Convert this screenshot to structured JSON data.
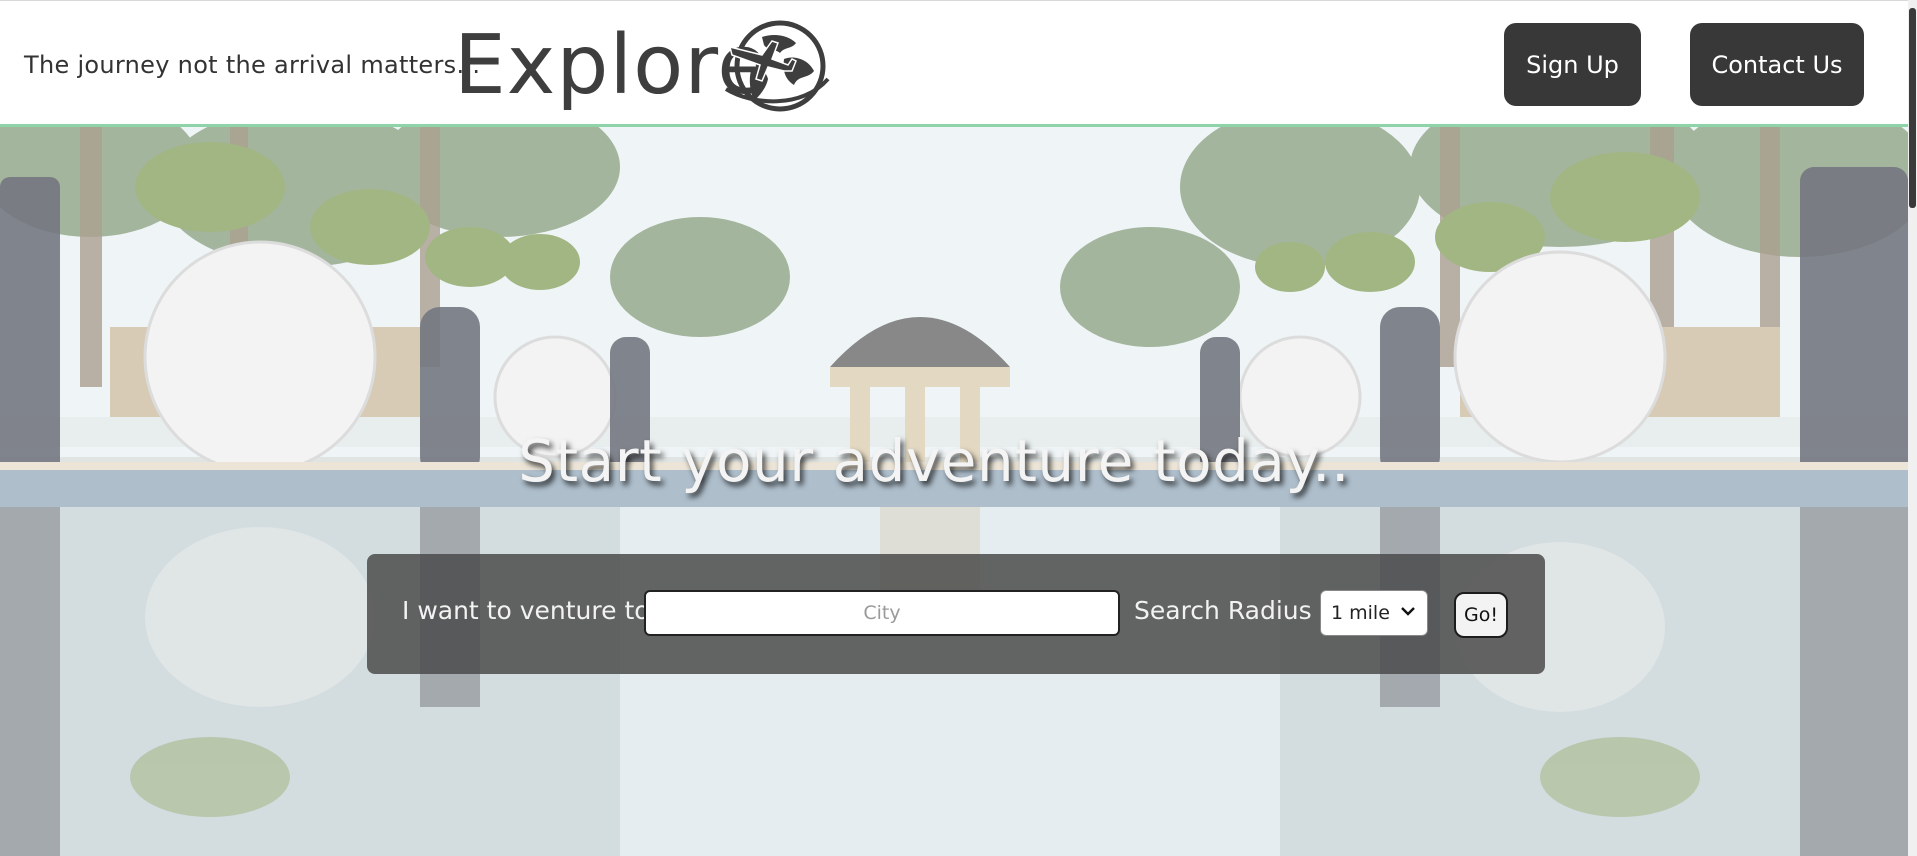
{
  "header": {
    "tagline": "The journey not the arrival matters...",
    "brand": "Explore",
    "logo_icon": "globe-airplane-icon",
    "nav": {
      "signup_label": "Sign Up",
      "contact_label": "Contact Us"
    }
  },
  "hero": {
    "headline": "Start your adventure today..",
    "search": {
      "venture_label": "I want to venture to",
      "city_placeholder": "City",
      "city_value": "",
      "radius_label": "Search Radius",
      "radius_selected": "1 mile",
      "go_label": "Go!"
    }
  },
  "colors": {
    "header_accent": "#8fd3a8",
    "nav_button_bg": "#383838",
    "brand_text": "#3e3e3e",
    "search_bar_bg": "#4b4b4b"
  }
}
